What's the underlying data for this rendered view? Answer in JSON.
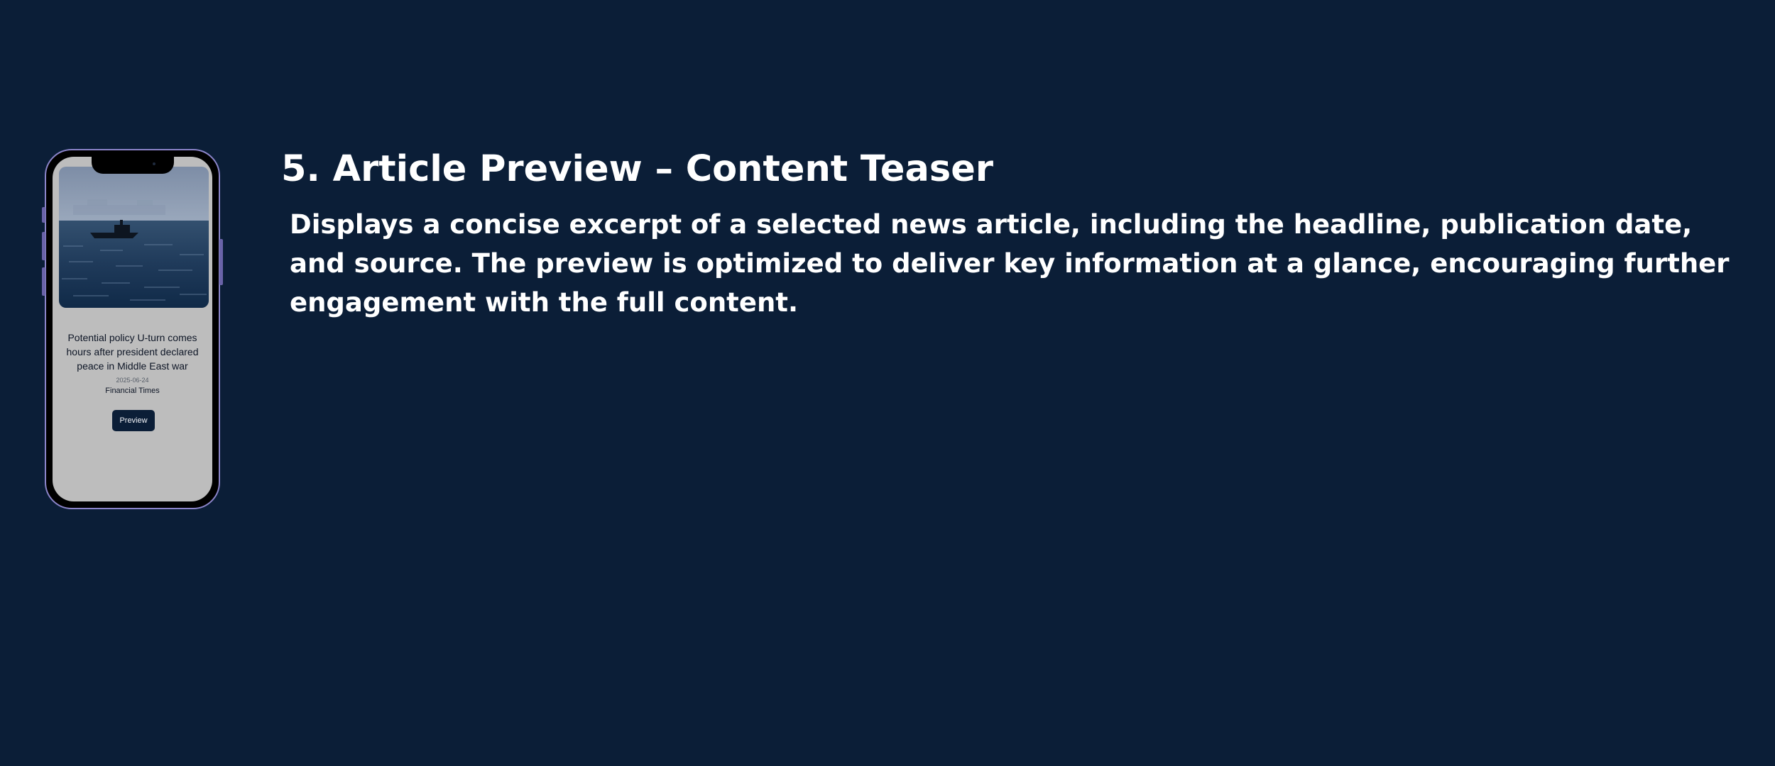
{
  "slide": {
    "title": "5. Article Preview – Content Teaser",
    "description": "Displays a concise excerpt of a selected news article, including the headline, publication date, and source. The preview is optimized to deliver key information at a glance, encouraging further engagement with the full content."
  },
  "article": {
    "headline": "Potential policy U-turn comes hours after president declared peace in Middle East war",
    "date": "2025-06-24",
    "source": "Financial Times",
    "preview_label": "Preview",
    "image_icon": "ship-at-sea-image"
  },
  "colors": {
    "background": "#0b1e37",
    "phone_frame": "#8b84c9",
    "screen": "#bdbdbd",
    "button": "#0b1e37",
    "text_light": "#ffffff",
    "text_dark": "#0e1626"
  }
}
